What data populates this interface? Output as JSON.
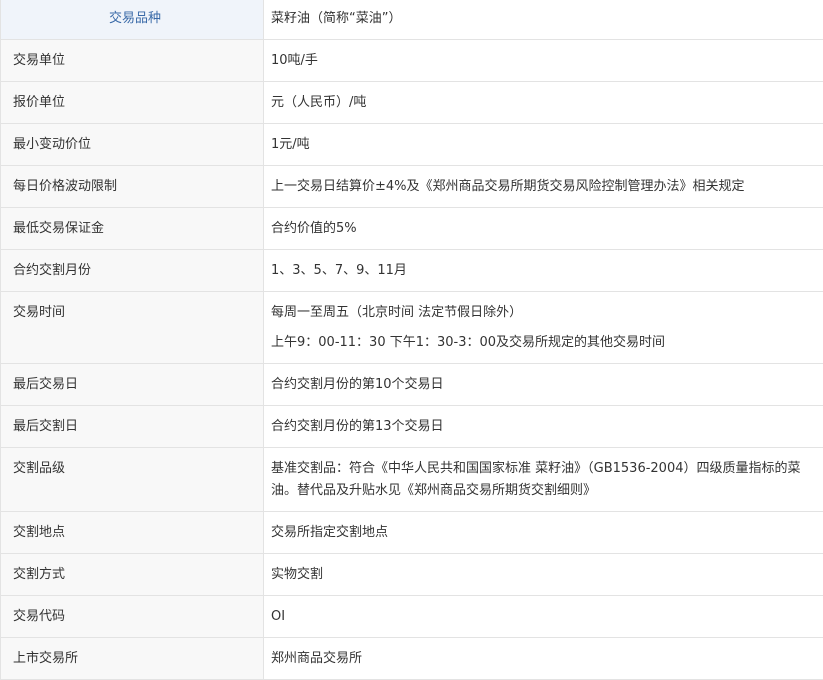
{
  "table": {
    "header": {
      "label": "交易品种",
      "value": "菜籽油（简称“菜油”）"
    },
    "rows": [
      {
        "label": "交易单位",
        "value": "10吨/手"
      },
      {
        "label": "报价单位",
        "value": "元（人民币）/吨"
      },
      {
        "label": "最小变动价位",
        "value": "1元/吨"
      },
      {
        "label": "每日价格波动限制",
        "value": "上一交易日结算价±4%及《郑州商品交易所期货交易风险控制管理办法》相关规定"
      },
      {
        "label": "最低交易保证金",
        "value": "合约价值的5%"
      },
      {
        "label": "合约交割月份",
        "value": "1、3、5、7、9、11月"
      },
      {
        "label": "交易时间",
        "value_line1": "每周一至周五（北京时间 法定节假日除外）",
        "value_line2": "上午9：00-11：30 下午1：30-3：00及交易所规定的其他交易时间"
      },
      {
        "label": "最后交易日",
        "value": "合约交割月份的第10个交易日"
      },
      {
        "label": "最后交割日",
        "value": "合约交割月份的第13个交易日"
      },
      {
        "label": "交割品级",
        "value": "基准交割品：符合《中华人民共和国国家标准 菜籽油》（GB1536-2004）四级质量指标的菜油。替代品及升贴水见《郑州商品交易所期货交割细则》"
      },
      {
        "label": "交割地点",
        "value": "交易所指定交割地点"
      },
      {
        "label": "交割方式",
        "value": "实物交割"
      },
      {
        "label": "交易代码",
        "value": "OI"
      },
      {
        "label": "上市交易所",
        "value": "郑州商品交易所"
      }
    ]
  }
}
